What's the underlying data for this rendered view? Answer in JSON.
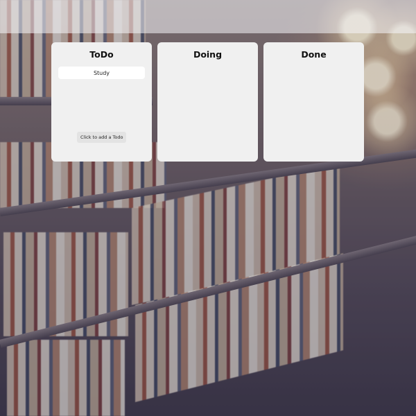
{
  "board": {
    "columns": [
      {
        "title": "ToDo",
        "cards": [
          "Study"
        ],
        "add_label": "Click to add a Todo"
      },
      {
        "title": "Doing",
        "cards": []
      },
      {
        "title": "Done",
        "cards": []
      }
    ]
  }
}
